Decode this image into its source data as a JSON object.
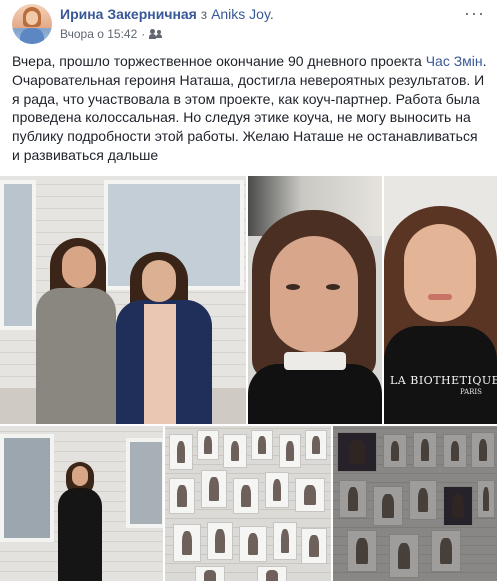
{
  "post": {
    "author": "Ирина Закерничная",
    "with_word": "з",
    "page": "Aniks Joy.",
    "time": "Вчора о 15:42",
    "dot": "·",
    "privacy_icon": "friends-icon",
    "menu_label": "···",
    "text_before_link": "Вчера, прошло торжественное окончание 90 дневного проекта ",
    "text_link": "Час Змін",
    "text_after_link": ". Очаровательная героиня Наташа, достигла невероятных результатов. И я рада, что участвовала в этом проекте, как коуч-партнер. Работа была проведена колоссальная. Но следуя этике коуча, не могу выносить на публику подробности этой работы. Желаю Наташе не останавливаться и развиваться дальше",
    "photos": {
      "p3_brand": "LA BIOTHETIQUE",
      "p3_brand_sub": "PARIS",
      "more_count": ""
    }
  },
  "colors": {
    "link": "#385898",
    "text": "#1d2129",
    "meta": "#606770"
  }
}
